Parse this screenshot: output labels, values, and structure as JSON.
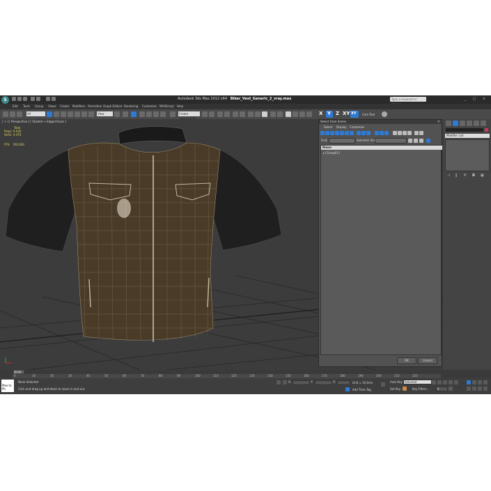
{
  "app": {
    "title_prefix": "Autodesk 3ds Max  2012 x64",
    "file_name": "Biker_Vest_Generic_2_vray.max",
    "search_placeholder": "Type a keyword or phrase",
    "window_controls": "_ □ ×"
  },
  "menu": [
    "Edit",
    "Tools",
    "Group",
    "Views",
    "Create",
    "Modifiers",
    "Animation",
    "Graph Editors",
    "Rendering",
    "Customize",
    "MAXScript",
    "Help"
  ],
  "toolbar": {
    "filter_combo": "All",
    "ref_coord": "View",
    "selection_set": "Create Selection Se",
    "axis_x": "X",
    "axis_y": "Y",
    "axis_z": "Z",
    "axis_xy": "XY",
    "axis_xy2": "XY",
    "cam_tools": "Cam Tool"
  },
  "viewport": {
    "label": "[ + ] [ Perspective ] [ Shaded + Edged Faces ]",
    "stats_title": "Total",
    "polys_label": "Polys:",
    "polys_value": "9 030",
    "verts_label": "Verts:",
    "verts_value": "4 470",
    "fps_label": "FPS:",
    "fps_value": "192,924"
  },
  "dialog": {
    "title": "Select From Scene",
    "tabs": [
      "Select",
      "Display",
      "Customize"
    ],
    "find_label": "Find:",
    "selection_set_label": "Selection Set:",
    "column_name": "Name",
    "rows": [
      "[Group01]"
    ],
    "ok": "OK",
    "cancel": "Cancel"
  },
  "command_panel": {
    "modifier_list": "Modifier List"
  },
  "timeline": {
    "counter": "0 / 225",
    "ticks": [
      "0",
      "10",
      "20",
      "30",
      "40",
      "50",
      "60",
      "70",
      "80",
      "90",
      "100",
      "110",
      "120",
      "130",
      "140",
      "150",
      "160",
      "170",
      "180",
      "190",
      "200",
      "210",
      "220"
    ]
  },
  "status": {
    "none_selected": "None Selected",
    "prompt": "Click and drag up-and-down to zoom in and out",
    "welcome": "Max to Ph",
    "x_label": "X:",
    "y_label": "Y:",
    "z_label": "Z:",
    "grid": "Grid = 10,0cm",
    "auto_key": "Auto Key",
    "selected": "Selected",
    "set_key": "Set Key",
    "key_filters": "Key Filters...",
    "add_time_tag": "Add Time Tag",
    "frame": "0"
  },
  "colors": {
    "accent_blue": "#2e7bd6",
    "viewport_bg": "#3c3c3c",
    "stats_yellow": "#e5d85a",
    "swatch_red": "#c8385a"
  }
}
